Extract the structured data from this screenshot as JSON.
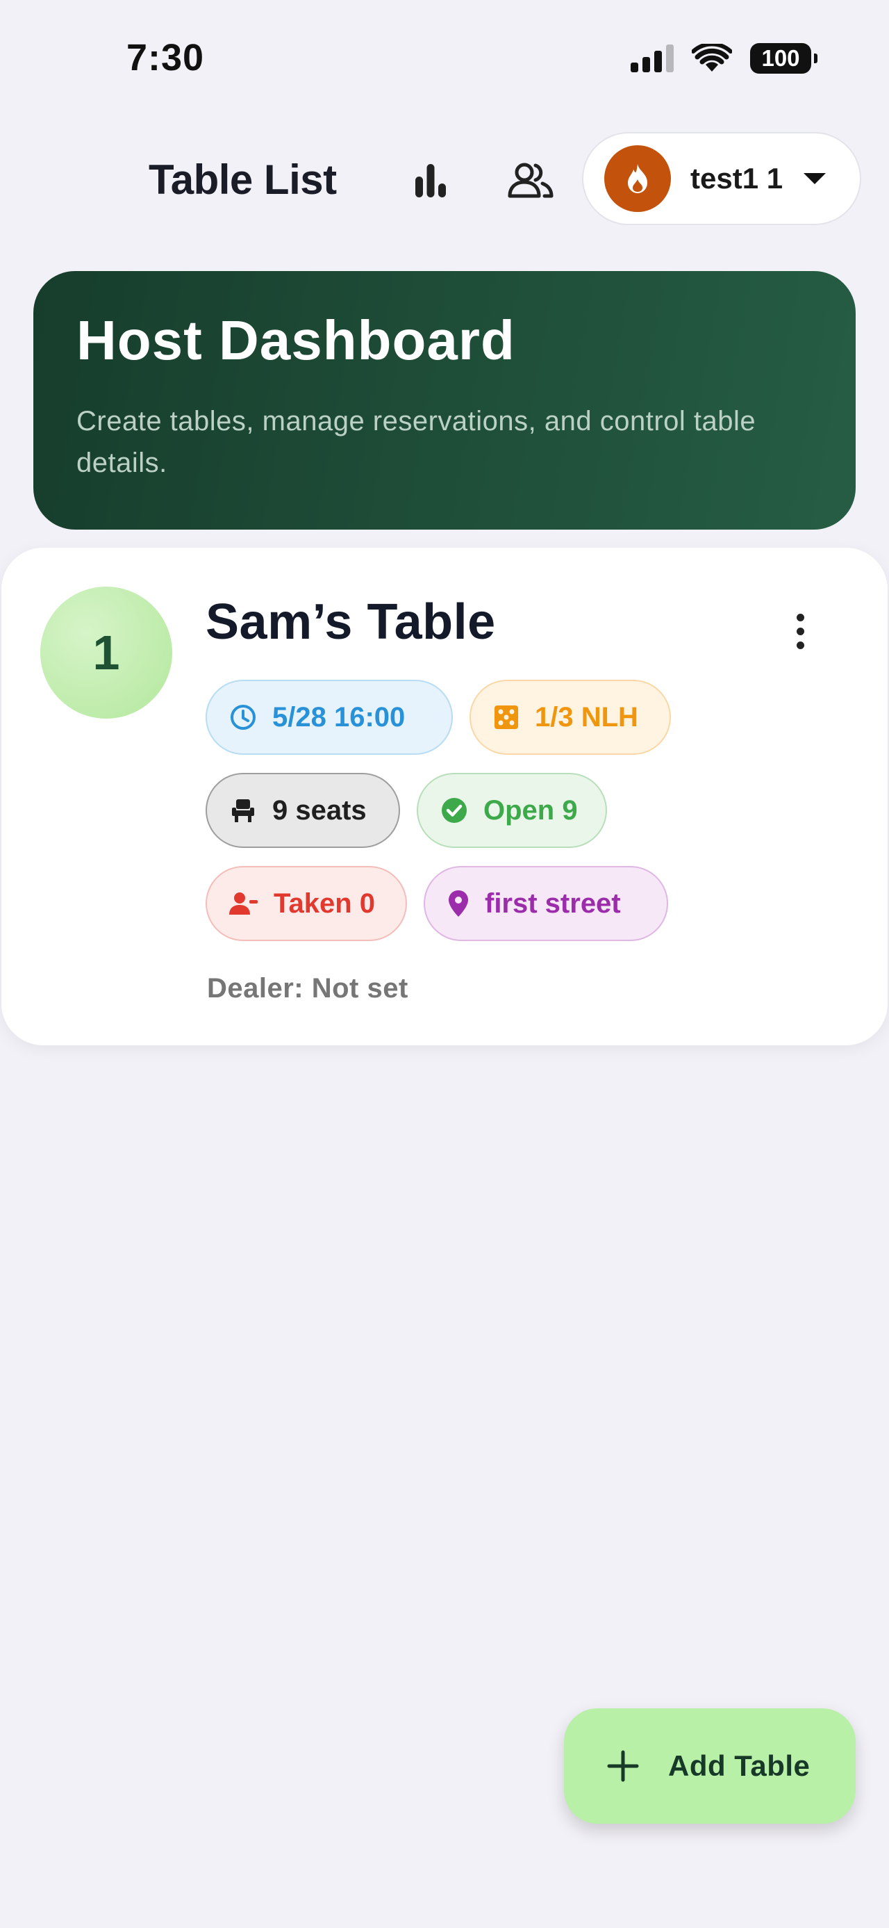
{
  "status_bar": {
    "time": "7:30",
    "battery": "100",
    "icons": [
      "signal-icon",
      "wifi-icon",
      "battery-icon"
    ]
  },
  "header": {
    "title": "Table List",
    "stats_icon": "bar-chart-icon",
    "people_icon": "people-icon",
    "user": {
      "name": "test1 1",
      "avatar_icon": "flame-icon",
      "avatar_color": "#c2520c"
    }
  },
  "banner": {
    "title": "Host Dashboard",
    "subtitle": "Create tables, manage reservations, and control table details.",
    "gradient": [
      "#173d2c",
      "#265d44"
    ]
  },
  "tables": [
    {
      "number": "1",
      "name": "Sam’s Table",
      "time": "5/28 16:00",
      "game": "1/3 NLH",
      "seats": "9 seats",
      "open": "Open 9",
      "taken": "Taken 0",
      "location": "first street",
      "dealer": "Dealer: Not set"
    }
  ],
  "fab": {
    "label": "Add Table",
    "icon": "plus-icon",
    "color": "#b8f0a8"
  },
  "colors": {
    "background": "#f2f1f7",
    "time_chip": "#2891d7",
    "game_chip": "#f0960e",
    "open_chip": "#3da94a",
    "taken_chip": "#e2392f",
    "location_chip": "#9b2dab"
  }
}
